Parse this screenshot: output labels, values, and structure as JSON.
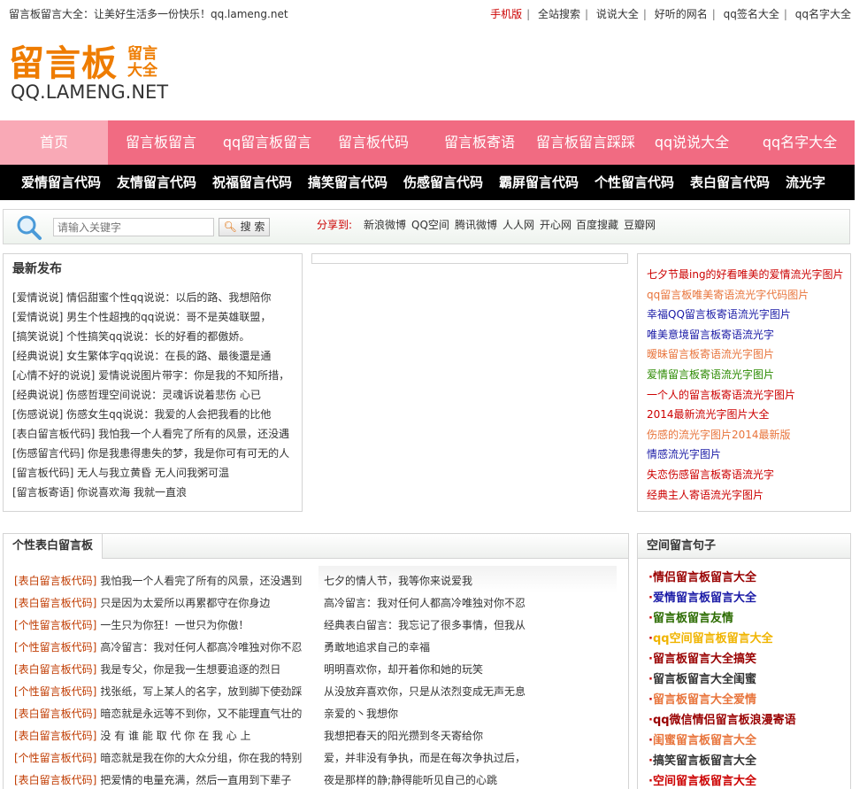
{
  "topbar": {
    "tagline": "留言板留言大全：让美好生活多一份快乐！qq.lameng.net",
    "links": [
      "手机版",
      "全站搜索",
      "说说大全",
      "好听的网名",
      "qq签名大全",
      "qq名字大全"
    ]
  },
  "logo": {
    "big": "留言板",
    "small": "留言大全",
    "domain": "QQ.LAMENG.NET"
  },
  "main_nav": [
    "首页",
    "留言板留言",
    "qq留言板留言",
    "留言板代码",
    "留言板寄语",
    "留言板留言踩踩",
    "qq说说大全",
    "qq名字大全"
  ],
  "sub_nav": [
    "爱情留言代码",
    "友情留言代码",
    "祝福留言代码",
    "搞笑留言代码",
    "伤感留言代码",
    "霸屏留言代码",
    "个性留言代码",
    "表白留言代码",
    "流光字"
  ],
  "search": {
    "placeholder": "请输入关键字",
    "button": "搜 索",
    "share_label": "分享到:",
    "share_targets": [
      "新浪微博",
      "QQ空间",
      "腾讯微博",
      "人人网",
      "开心网",
      "百度搜藏",
      "豆瓣网"
    ]
  },
  "latest": {
    "title": "最新发布",
    "items": [
      "[爱情说说] 情侣甜蜜个性qq说说：以后的路、我想陪你",
      "[爱情说说] 男生个性超拽的qq说说：哥不是英雄联盟，",
      "[搞笑说说] 个性搞笑qq说说：长的好看的都傲娇。",
      "[经典说说] 女生繁体字qq说说：在長的路、最後還是通",
      "[心情不好的说说] 爱情说说图片带字：你是我的不知所措，",
      "[经典说说] 伤感哲理空间说说：灵魂诉说着悲伤 心已",
      "[伤感说说] 伤感女生qq说说：我爱的人会把我看的比他",
      "[表白留言板代码] 我怕我一个人看完了所有的风景，还没遇",
      "[伤感留言代码] 你是我患得患失的梦，我是你可有可无的人",
      "[留言板代码] 无人与我立黄昏 无人问我粥可温",
      "[留言板寄语] 你说喜欢海 我就一直浪"
    ]
  },
  "right_links": [
    {
      "text": "七夕节最ing的好看唯美的爱情流光字图片",
      "color": "#cc0000"
    },
    {
      "text": "qq留言板唯美寄语流光字代码图片",
      "color": "#e8743b"
    },
    {
      "text": "幸福QQ留言板寄语流光字图片",
      "color": "#1a1aa6"
    },
    {
      "text": "唯美意境留言板寄语流光字",
      "color": "#1a1aa6"
    },
    {
      "text": "暧昧留言板寄语流光字图片",
      "color": "#e8743b"
    },
    {
      "text": "爱情留言板寄语流光字图片",
      "color": "#2b8a00"
    },
    {
      "text": "一个人的留言板寄语流光字图片",
      "color": "#cc0000"
    },
    {
      "text": "2014最新流光字图片大全",
      "color": "#cc0000"
    },
    {
      "text": "伤感的流光字图片2014最新版",
      "color": "#e8743b"
    },
    {
      "text": "情感流光字图片",
      "color": "#1a1aa6"
    },
    {
      "text": "失恋伤感留言板寄语流光字",
      "color": "#cc0000"
    },
    {
      "text": "经典主人寄语流光字图片",
      "color": "#cc0000"
    }
  ],
  "biaobai": {
    "title": "个性表白留言板",
    "left_items": [
      {
        "cat": "[表白留言板代码]",
        "text": "我怕我一个人看完了所有的风景，还没遇到"
      },
      {
        "cat": "[表白留言板代码]",
        "text": "只是因为太爱所以再累都守在你身边"
      },
      {
        "cat": "[个性留言板代码]",
        "text": "一生只为你狂！一世只为你傲！"
      },
      {
        "cat": "[个性留言板代码]",
        "text": "高冷留言：我对任何人都高冷唯独对你不忍"
      },
      {
        "cat": "[表白留言板代码]",
        "text": "我是专父，你是我一生想要追逐的烈日"
      },
      {
        "cat": "[个性留言板代码]",
        "text": "找张纸，写上某人的名字，放到脚下使劲踩"
      },
      {
        "cat": "[表白留言板代码]",
        "text": "暗恋就是永远等不到你，又不能理直气壮的"
      },
      {
        "cat": "[表白留言板代码]",
        "text": "没 有 谁 能 取 代 你 在 我 心 上"
      },
      {
        "cat": "[个性留言板代码]",
        "text": "暗恋就是我在你的大众分组，你在我的特别"
      },
      {
        "cat": "[表白留言板代码]",
        "text": "把爱情的电量充满，然后一直用到下辈子"
      }
    ],
    "right_items": [
      "七夕的情人节，我等你来说爱我",
      "高冷留言：我对任何人都高冷唯独对你不忍",
      "经典表白留言：我忘记了很多事情，但我从",
      "勇敢地追求自己的幸福",
      "明明喜欢你，却开着你和她的玩笑",
      "从没放弃喜欢你，只是从浓烈变成无声无息",
      "亲爱的丶我想你",
      "我想把春天的阳光攒到冬天寄给你",
      "爱，并非没有争执，而是在每次争执过后，",
      "夜是那样的静;静得能听见自己的心跳"
    ]
  },
  "kongjian": {
    "title": "空间留言句子",
    "items": [
      {
        "text": "情侣留言板留言大全",
        "color": "#990000"
      },
      {
        "text": "爱情留言板留言大全",
        "color": "#1a1aa6"
      },
      {
        "text": "留言板留言友情",
        "color": "#2b6b00"
      },
      {
        "text": "qq空间留言板留言大全",
        "color": "#f0b400"
      },
      {
        "text": "留言板留言大全搞笑",
        "color": "#990000"
      },
      {
        "text": "留言板留言大全闺蜜",
        "color": "#333333"
      },
      {
        "text": "留言板留言大全爱情",
        "color": "#e8743b"
      },
      {
        "text": "qq微信情侣留言板浪漫寄语",
        "color": "#990000"
      },
      {
        "text": "闺蜜留言板留言大全",
        "color": "#e8743b"
      },
      {
        "text": "搞笑留言板留言大全",
        "color": "#333333"
      },
      {
        "text": "空间留言板留言大全",
        "color": "#cc0000"
      }
    ]
  }
}
